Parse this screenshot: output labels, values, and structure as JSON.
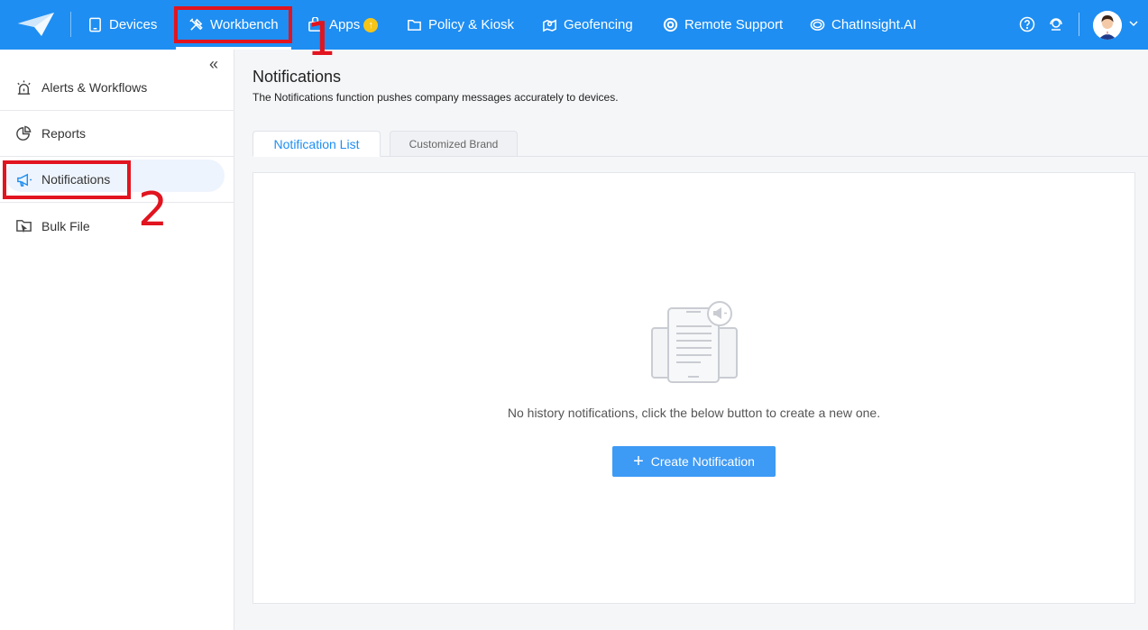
{
  "topbar": {
    "logo_icon": "paper-plane-logo-icon",
    "nav": [
      {
        "label": "Devices",
        "icon": "tablet-icon"
      },
      {
        "label": "Workbench",
        "icon": "tools-icon"
      },
      {
        "label": "Apps",
        "icon": "apps-icon",
        "badge": "↑"
      },
      {
        "label": "Policy & Kiosk",
        "icon": "folder-icon"
      },
      {
        "label": "Geofencing",
        "icon": "map-pin-icon"
      },
      {
        "label": "Remote Support",
        "icon": "lifebuoy-icon"
      },
      {
        "label": "ChatInsight.AI",
        "icon": "chat-ai-icon"
      }
    ],
    "active_nav": "Workbench",
    "help_icon": "help-icon",
    "support_icon": "agent-icon",
    "accent_color": "#1e8ef2"
  },
  "annotations": [
    {
      "number": "1",
      "target": "Workbench",
      "color": "#e1141f"
    },
    {
      "number": "2",
      "target": "Notifications",
      "color": "#e1141f"
    }
  ],
  "sidebar": {
    "collapse_symbol": "«",
    "items": [
      {
        "label": "Alerts & Workflows",
        "icon": "alarm-icon"
      },
      {
        "label": "Reports",
        "icon": "pie-chart-icon"
      },
      {
        "label": "Notifications",
        "icon": "megaphone-icon",
        "active": true
      },
      {
        "label": "Bulk File",
        "icon": "folder-upload-icon"
      }
    ]
  },
  "main": {
    "title": "Notifications",
    "description": "The Notifications function pushes company messages accurately to devices.",
    "tabs": [
      {
        "label": "Notification List",
        "active": true
      },
      {
        "label": "Customized Brand",
        "active": false
      }
    ],
    "empty_state": {
      "illustration": "phone-notification-illustration",
      "text": "No history notifications, click the below button to create a new one."
    },
    "create_button": {
      "label": "Create Notification",
      "icon": "plus-icon"
    }
  }
}
